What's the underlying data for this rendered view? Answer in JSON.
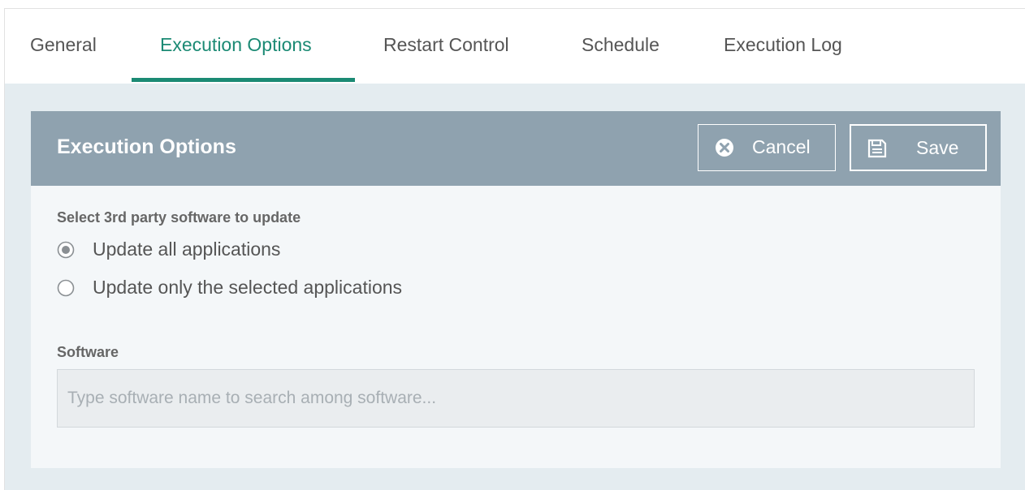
{
  "tabs": [
    {
      "label": "General",
      "active": false
    },
    {
      "label": "Execution Options",
      "active": true
    },
    {
      "label": "Restart Control",
      "active": false
    },
    {
      "label": "Schedule",
      "active": false
    },
    {
      "label": "Execution Log",
      "active": false
    }
  ],
  "panel": {
    "title": "Execution Options",
    "cancel_label": "Cancel",
    "save_label": "Save",
    "cancel_icon": "close-circle-icon",
    "save_icon": "floppy-disk-icon"
  },
  "update_section": {
    "label": "Select 3rd party software to update",
    "options": [
      {
        "label": "Update all applications",
        "selected": true
      },
      {
        "label": "Update only the selected applications",
        "selected": false
      }
    ]
  },
  "software": {
    "label": "Software",
    "value": "",
    "placeholder": "Type software name to search among software..."
  },
  "colors": {
    "accent": "#1b8a74",
    "header_bg": "#8fa2af",
    "content_bg": "#e4ecf0",
    "panel_bg": "#f4f7f9"
  }
}
